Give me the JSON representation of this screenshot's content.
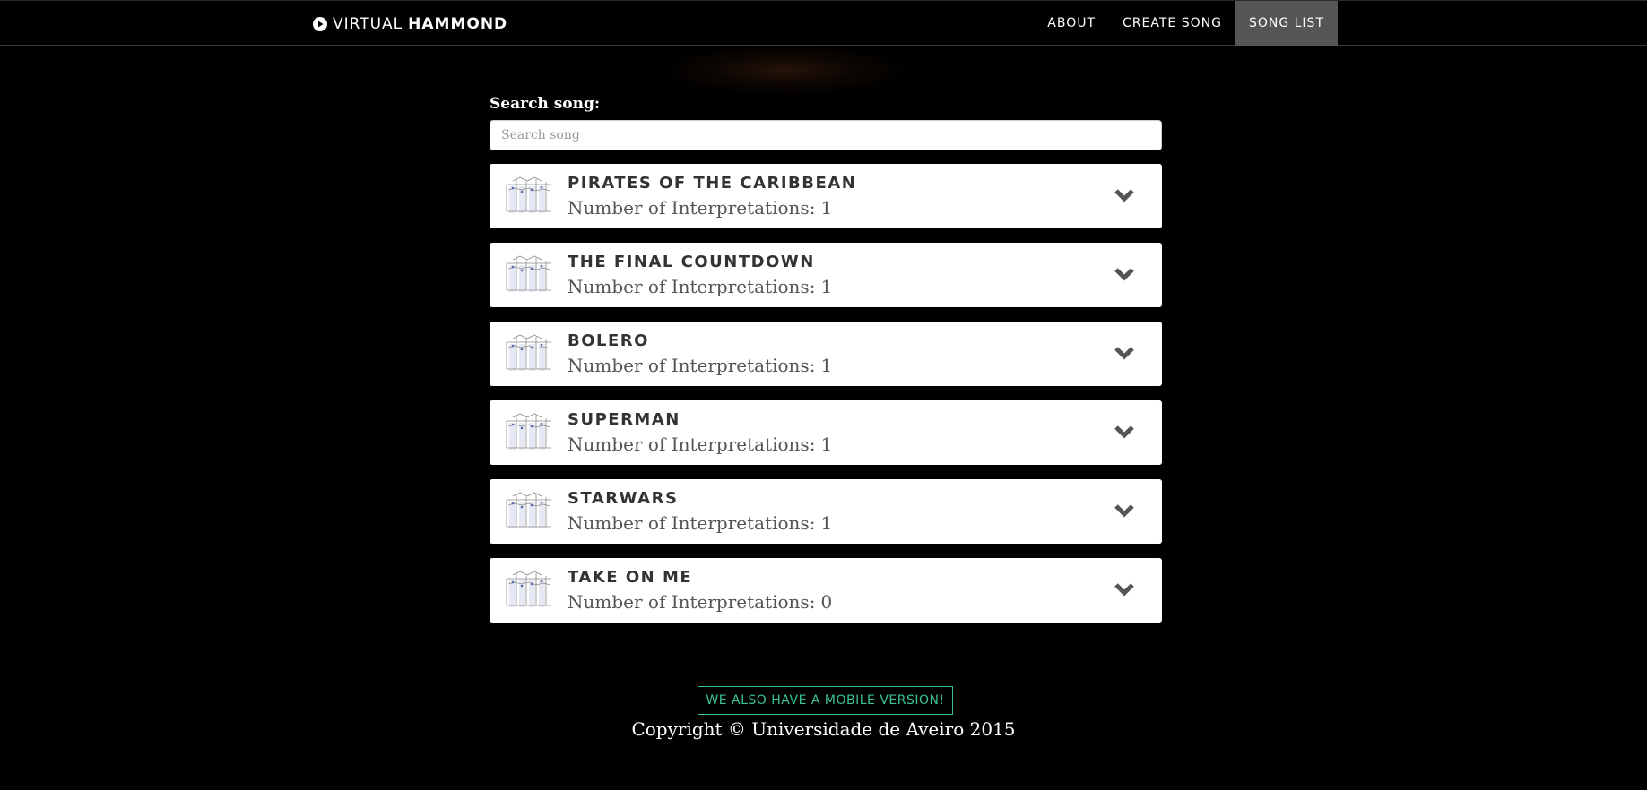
{
  "navbar": {
    "brand_light": "VIRTUAL",
    "brand_bold": "HAMMOND",
    "brand_icon": "play-circle-icon",
    "items": [
      {
        "label": "ABOUT"
      },
      {
        "label": "CREATE SONG"
      },
      {
        "label": "SONG LIST",
        "active": true
      }
    ]
  },
  "search": {
    "label": "Search song:",
    "placeholder": "Search song",
    "value": ""
  },
  "songs": [
    {
      "title": "PIRATES OF THE CARIBBEAN",
      "count_label": "Number of Interpretations:",
      "count": "1"
    },
    {
      "title": "THE FINAL COUNTDOWN",
      "count_label": "Number of Interpretations:",
      "count": "1"
    },
    {
      "title": "BOLERO",
      "count_label": "Number of Interpretations:",
      "count": "1"
    },
    {
      "title": "SUPERMAN",
      "count_label": "Number of Interpretations:",
      "count": "1"
    },
    {
      "title": "STARWARS",
      "count_label": "Number of Interpretations:",
      "count": "1"
    },
    {
      "title": "TAKE ON ME",
      "count_label": "Number of Interpretations:",
      "count": "0"
    }
  ],
  "song_thumbnail_icon": "sheet-music-icon",
  "expand_icon": "chevron-down-icon",
  "footer": {
    "mobile_button": "WE ALSO HAVE A MOBILE VERSION!",
    "copyright": "Copyright © Universidade de Aveiro 2015"
  },
  "colors": {
    "background": "#000000",
    "accent": "#3cc195",
    "nav_active": "#555555",
    "card": "#ffffff",
    "title_text": "#333333"
  }
}
